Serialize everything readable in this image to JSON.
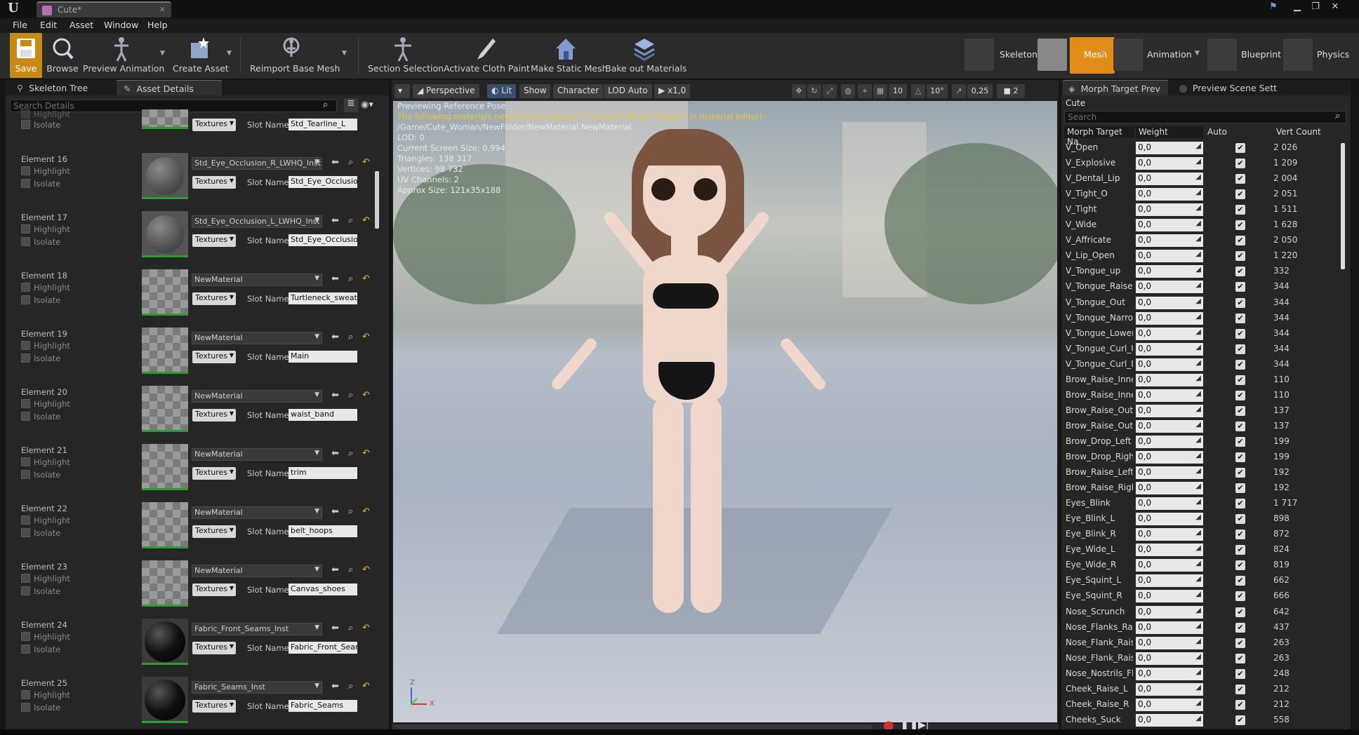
{
  "window": {
    "tab_title": "Cute*",
    "menu": [
      "File",
      "Edit",
      "Asset",
      "Window",
      "Help"
    ]
  },
  "toolbar": {
    "buttons": [
      {
        "label": "Save",
        "icon": "save-icon"
      },
      {
        "label": "Browse",
        "icon": "browse-icon"
      },
      {
        "label": "Preview Animation",
        "icon": "preview-animation-icon"
      },
      {
        "label": "Create Asset",
        "icon": "create-asset-icon"
      },
      {
        "label": "Reimport Base Mesh",
        "icon": "reimport-icon"
      },
      {
        "label": "Section Selection",
        "icon": "section-selection-icon"
      },
      {
        "label": "Activate Cloth Paint",
        "icon": "cloth-paint-icon"
      },
      {
        "label": "Make Static Mesh",
        "icon": "static-mesh-icon"
      },
      {
        "label": "Bake out Materials",
        "icon": "bake-materials-icon"
      }
    ],
    "modes": [
      "Skeleton",
      "Mesh",
      "Animation",
      "Blueprint",
      "Physics"
    ]
  },
  "left_panel": {
    "tabs": [
      "Skeleton Tree",
      "Asset Details"
    ],
    "search_placeholder": "Search Details",
    "highlight_label": "Highlight",
    "isolate_label": "Isolate",
    "textures_label": "Textures",
    "slot_name_label": "Slot Name",
    "top_partial": {
      "slot": "Std_Tearline_L"
    },
    "elements": [
      {
        "title": "Element 16",
        "material": "Std_Eye_Occlusion_R_LWHQ_Inst",
        "slot": "Std_Eye_Occlusio",
        "thumb": "sphere-grey"
      },
      {
        "title": "Element 17",
        "material": "Std_Eye_Occlusion_L_LWHQ_Inst",
        "slot": "Std_Eye_Occlusio",
        "thumb": "sphere-grey"
      },
      {
        "title": "Element 18",
        "material": "NewMaterial",
        "slot": "Turtleneck_sweat",
        "thumb": "checker"
      },
      {
        "title": "Element 19",
        "material": "NewMaterial",
        "slot": "Main",
        "thumb": "checker"
      },
      {
        "title": "Element 20",
        "material": "NewMaterial",
        "slot": "waist_band",
        "thumb": "checker"
      },
      {
        "title": "Element 21",
        "material": "NewMaterial",
        "slot": "trim",
        "thumb": "checker"
      },
      {
        "title": "Element 22",
        "material": "NewMaterial",
        "slot": "belt_hoops",
        "thumb": "checker"
      },
      {
        "title": "Element 23",
        "material": "NewMaterial",
        "slot": "Canvas_shoes",
        "thumb": "checker"
      },
      {
        "title": "Element 24",
        "material": "Fabric_Front_Seams_Inst",
        "slot": "Fabric_Front_Sear",
        "thumb": "sphere-black"
      },
      {
        "title": "Element 25",
        "material": "Fabric_Seams_Inst",
        "slot": "Fabric_Seams",
        "thumb": "sphere-black"
      }
    ]
  },
  "viewport": {
    "buttons": [
      "Perspective",
      "Lit",
      "Show",
      "Character",
      "LOD Auto",
      "x1,0"
    ],
    "grid_value": "10",
    "angle_value": "10°",
    "scale_value": "0,25",
    "camera_speed": "2",
    "info": [
      {
        "text": "Previewing Reference Pose",
        "warn": false
      },
      {
        "text": "The following materials need morph support ('Used with Morph Targets' in material editor):",
        "warn": true
      },
      {
        "text": "/Game/Cute_Woman/NewFolder/NewMaterial.NewMaterial",
        "warn": false
      },
      {
        "text": "LOD: 0",
        "warn": false
      },
      {
        "text": "Current Screen Size: 0,994",
        "warn": false
      },
      {
        "text": "Triangles: 138 317",
        "warn": false
      },
      {
        "text": "Vertices: 98 732",
        "warn": false
      },
      {
        "text": "UV Channels: 2",
        "warn": false
      },
      {
        "text": "Approx Size: 121x35x188",
        "warn": false
      }
    ],
    "axis_z": "Z",
    "axis_x": "X"
  },
  "right_panel": {
    "tabs": [
      "Morph Target Prev",
      "Preview Scene Sett"
    ],
    "asset_name": "Cute",
    "search_placeholder": "Search",
    "columns": [
      "Morph Target Na",
      "Weight",
      "Auto",
      "Vert Count"
    ],
    "rows": [
      {
        "name": "V_Open",
        "weight": "0,0",
        "verts": "2 026"
      },
      {
        "name": "V_Explosive",
        "weight": "0,0",
        "verts": "1 209"
      },
      {
        "name": "V_Dental_Lip",
        "weight": "0,0",
        "verts": "2 004"
      },
      {
        "name": "V_Tight_O",
        "weight": "0,0",
        "verts": "2 051"
      },
      {
        "name": "V_Tight",
        "weight": "0,0",
        "verts": "1 511"
      },
      {
        "name": "V_Wide",
        "weight": "0,0",
        "verts": "1 628"
      },
      {
        "name": "V_Affricate",
        "weight": "0,0",
        "verts": "2 050"
      },
      {
        "name": "V_Lip_Open",
        "weight": "0,0",
        "verts": "1 220"
      },
      {
        "name": "V_Tongue_up",
        "weight": "0,0",
        "verts": "332"
      },
      {
        "name": "V_Tongue_Raise",
        "weight": "0,0",
        "verts": "344"
      },
      {
        "name": "V_Tongue_Out",
        "weight": "0,0",
        "verts": "344"
      },
      {
        "name": "V_Tongue_Narrow",
        "weight": "0,0",
        "verts": "344"
      },
      {
        "name": "V_Tongue_Lower",
        "weight": "0,0",
        "verts": "344"
      },
      {
        "name": "V_Tongue_Curl_U",
        "weight": "0,0",
        "verts": "344"
      },
      {
        "name": "V_Tongue_Curl_D",
        "weight": "0,0",
        "verts": "344"
      },
      {
        "name": "Brow_Raise_Inner",
        "weight": "0,0",
        "verts": "110"
      },
      {
        "name": "Brow_Raise_Inner",
        "weight": "0,0",
        "verts": "110"
      },
      {
        "name": "Brow_Raise_Outer",
        "weight": "0,0",
        "verts": "137"
      },
      {
        "name": "Brow_Raise_Outer",
        "weight": "0,0",
        "verts": "137"
      },
      {
        "name": "Brow_Drop_Left",
        "weight": "0,0",
        "verts": "199"
      },
      {
        "name": "Brow_Drop_Right",
        "weight": "0,0",
        "verts": "199"
      },
      {
        "name": "Brow_Raise_Left",
        "weight": "0,0",
        "verts": "192"
      },
      {
        "name": "Brow_Raise_Right",
        "weight": "0,0",
        "verts": "192"
      },
      {
        "name": "Eyes_Blink",
        "weight": "0,0",
        "verts": "1 717"
      },
      {
        "name": "Eye_Blink_L",
        "weight": "0,0",
        "verts": "898"
      },
      {
        "name": "Eye_Blink_R",
        "weight": "0,0",
        "verts": "872"
      },
      {
        "name": "Eye_Wide_L",
        "weight": "0,0",
        "verts": "824"
      },
      {
        "name": "Eye_Wide_R",
        "weight": "0,0",
        "verts": "819"
      },
      {
        "name": "Eye_Squint_L",
        "weight": "0,0",
        "verts": "662"
      },
      {
        "name": "Eye_Squint_R",
        "weight": "0,0",
        "verts": "666"
      },
      {
        "name": "Nose_Scrunch",
        "weight": "0,0",
        "verts": "642"
      },
      {
        "name": "Nose_Flanks_Raise",
        "weight": "0,0",
        "verts": "437"
      },
      {
        "name": "Nose_Flank_Raise",
        "weight": "0,0",
        "verts": "263"
      },
      {
        "name": "Nose_Flank_Raise",
        "weight": "0,0",
        "verts": "263"
      },
      {
        "name": "Nose_Nostrils_Flare",
        "weight": "0,0",
        "verts": "248"
      },
      {
        "name": "Cheek_Raise_L",
        "weight": "0,0",
        "verts": "212"
      },
      {
        "name": "Cheek_Raise_R",
        "weight": "0,0",
        "verts": "212"
      },
      {
        "name": "Cheeks_Suck",
        "weight": "0,0",
        "verts": "558"
      }
    ]
  }
}
